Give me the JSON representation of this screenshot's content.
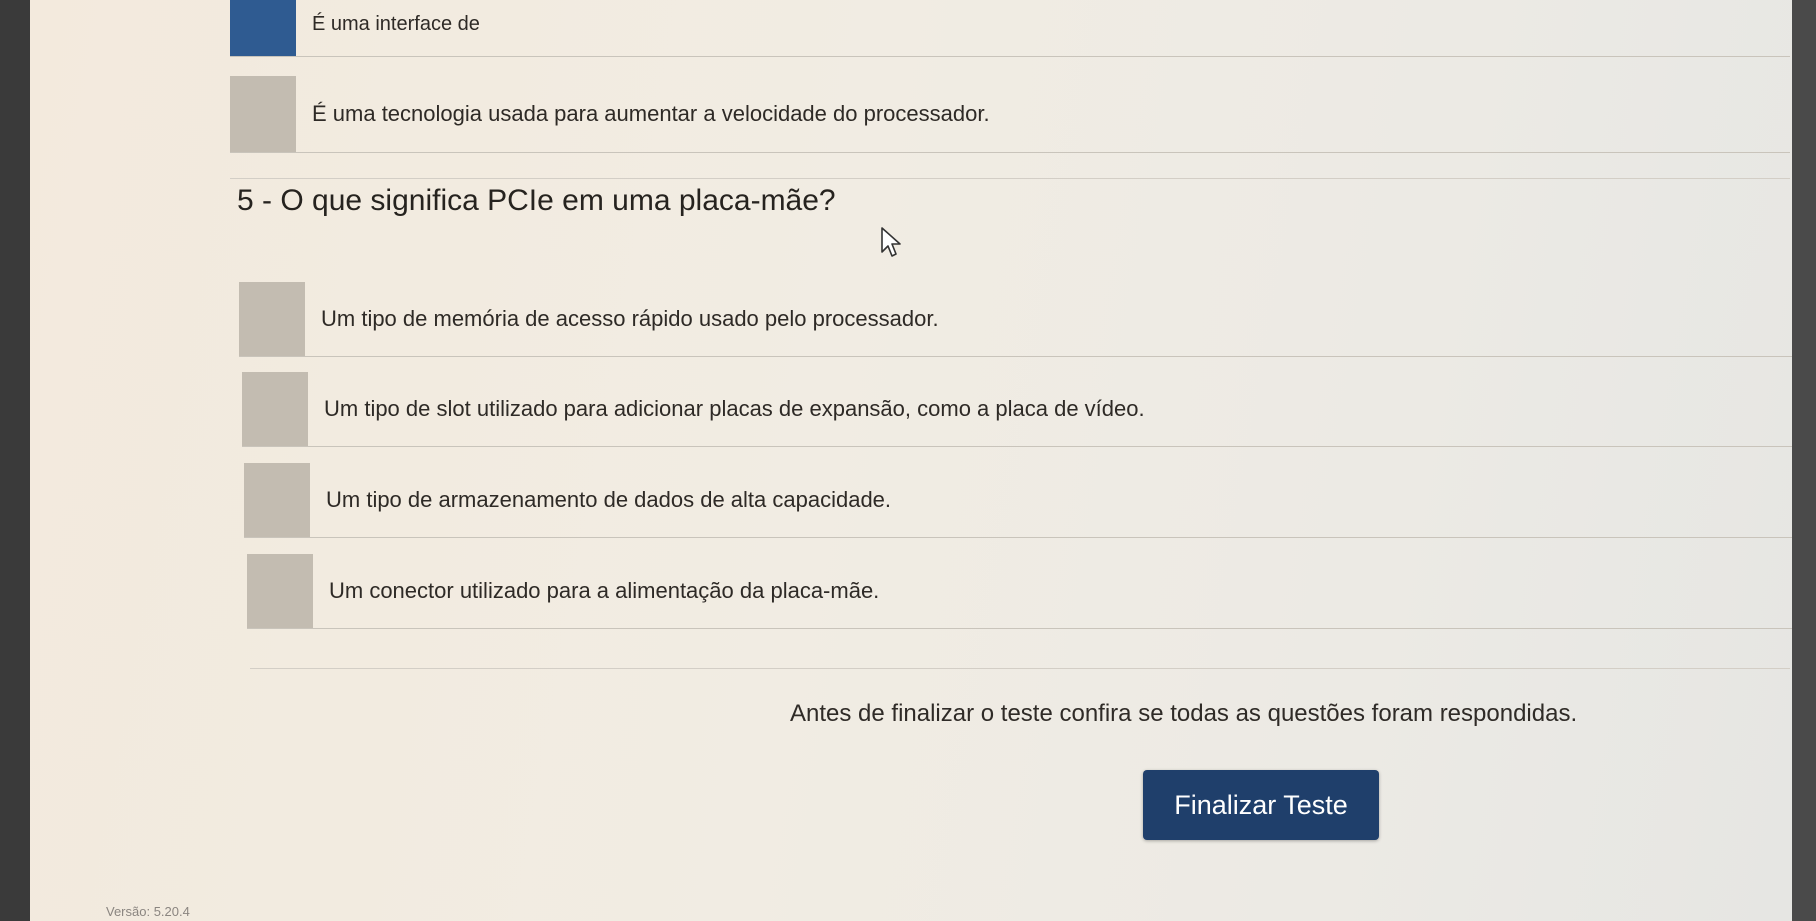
{
  "previous_question": {
    "options": [
      {
        "label": "É uma interface de",
        "selected": true
      },
      {
        "label": "É uma tecnologia usada para aumentar a velocidade do processador.",
        "selected": false
      }
    ]
  },
  "question": {
    "title": "5 - O que significa PCIe em uma placa-mãe?",
    "options": [
      {
        "label": "Um tipo de memória de acesso rápido usado pelo processador."
      },
      {
        "label": "Um tipo de slot utilizado para adicionar placas de expansão, como a placa de vídeo."
      },
      {
        "label": "Um tipo de armazenamento de dados de alta capacidade."
      },
      {
        "label": "Um conector utilizado para a alimentação da placa-mãe."
      }
    ]
  },
  "notice": "Antes de finalizar o teste confira se todas as questões foram respondidas.",
  "finish_button": "Finalizar Teste",
  "footer": "Versão: 5.20.4",
  "colors": {
    "selected_marker": "#2f5b91",
    "unselected_marker": "#c3bcb1",
    "button": "#1f3f6b"
  }
}
